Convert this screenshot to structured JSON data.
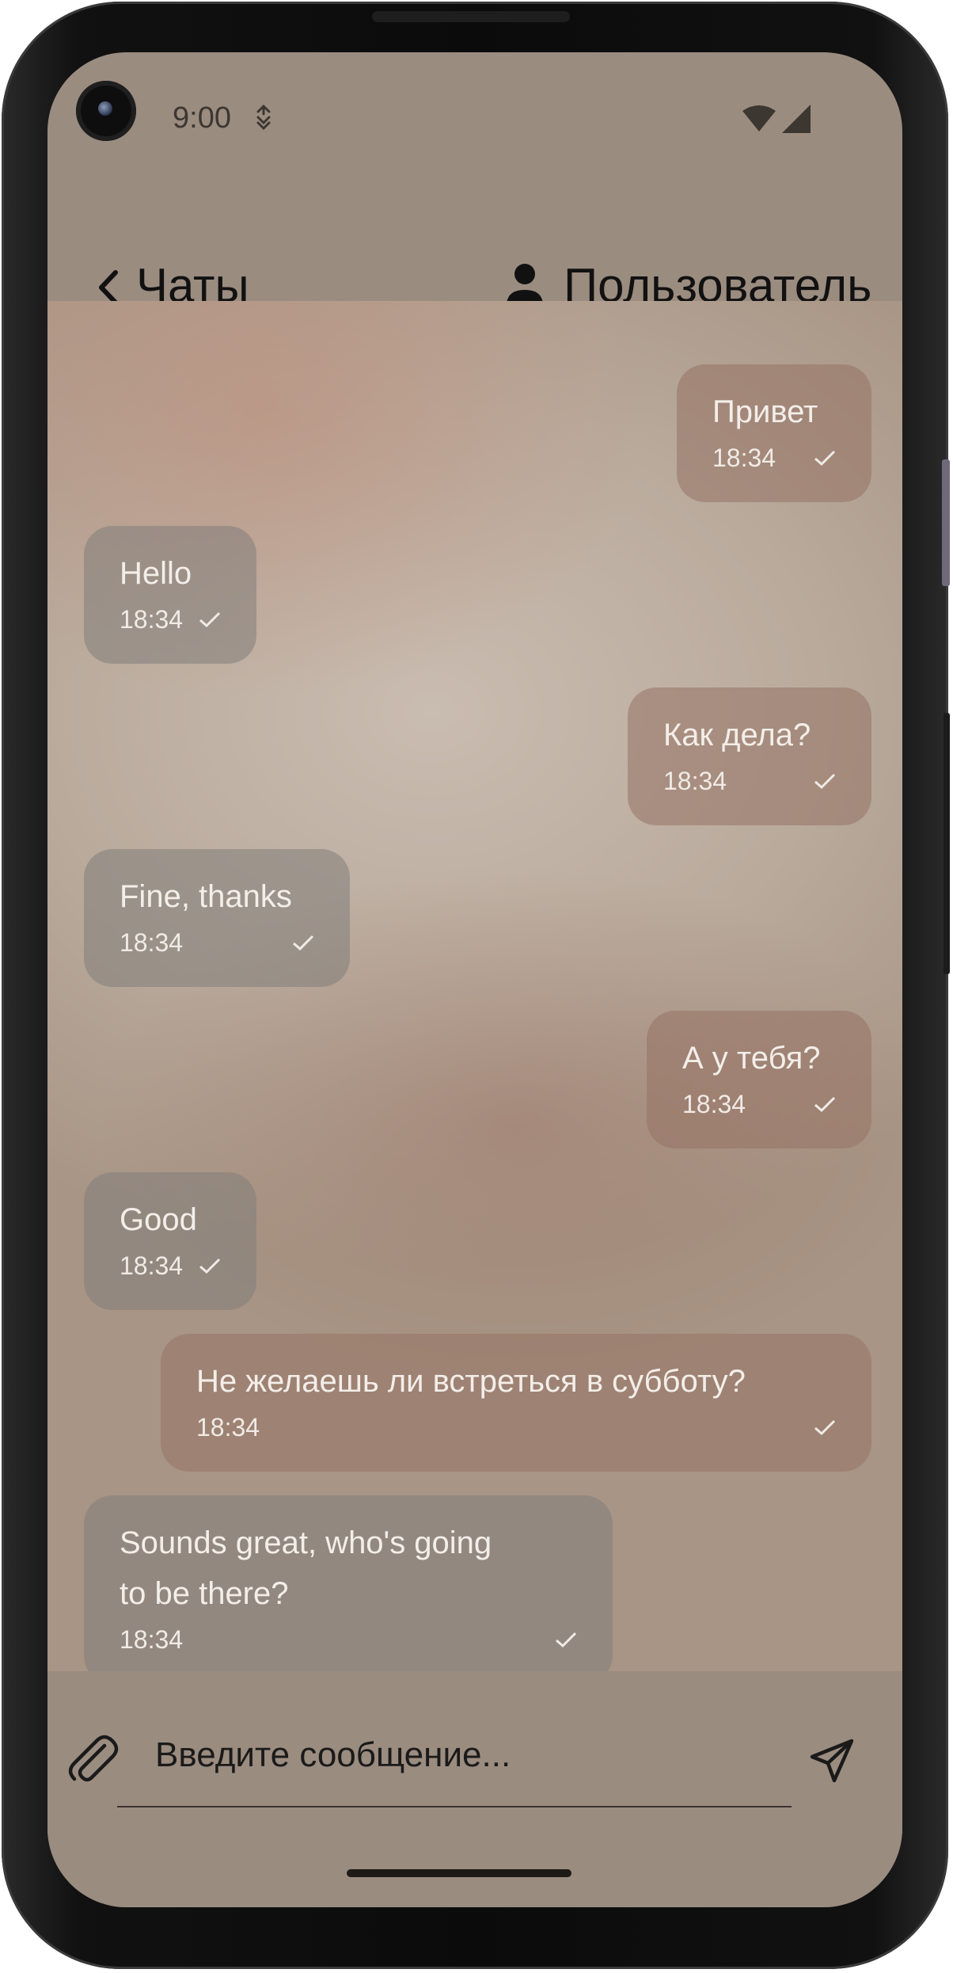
{
  "status_bar": {
    "time": "9:00",
    "icons": [
      "cell-data-icon",
      "wifi-icon",
      "signal-icon"
    ]
  },
  "app_bar": {
    "back_icon": "chevron-left-icon",
    "title": "Чаты",
    "user_icon": "person-icon",
    "user_name": "Пользователь"
  },
  "messages": [
    {
      "direction": "outgoing",
      "text": "Привет",
      "time": "18:34",
      "status_icon": "check-icon"
    },
    {
      "direction": "incoming",
      "text": "Hello",
      "time": "18:34",
      "status_icon": "check-icon"
    },
    {
      "direction": "outgoing",
      "text": "Как дела?",
      "time": "18:34",
      "status_icon": "check-icon"
    },
    {
      "direction": "incoming",
      "text": "Fine, thanks",
      "time": "18:34",
      "status_icon": "check-icon"
    },
    {
      "direction": "outgoing",
      "text": "А у тебя?",
      "time": "18:34",
      "status_icon": "check-icon"
    },
    {
      "direction": "incoming",
      "text": "Good",
      "time": "18:34",
      "status_icon": "check-icon"
    },
    {
      "direction": "outgoing",
      "text": "Не желаешь ли встреться в субботу?",
      "time": "18:34",
      "status_icon": "check-icon"
    },
    {
      "direction": "incoming",
      "text": "Sounds great, who's going\nto be there?",
      "time": "18:34",
      "status_icon": "check-icon"
    }
  ],
  "composer": {
    "attach_icon": "paperclip-icon",
    "placeholder": "Введите сообщение...",
    "value": "",
    "send_icon": "send-icon"
  },
  "colors": {
    "bar_background": "#9b8c80",
    "outgoing_bubble": "#96735f",
    "incoming_bubble": "#827d7a"
  }
}
